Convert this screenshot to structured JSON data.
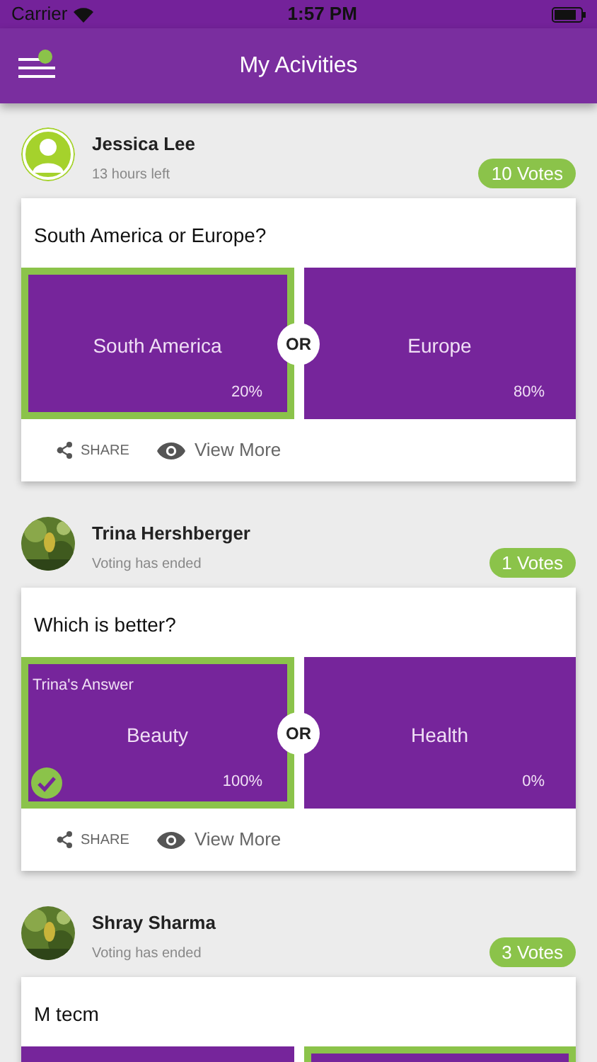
{
  "status_bar": {
    "carrier": "Carrier",
    "time": "1:57 PM"
  },
  "nav": {
    "title": "My Acivities",
    "menu_dot": true
  },
  "posts": [
    {
      "author": "Jessica Lee",
      "subtitle": "13 hours left",
      "votes": "10 Votes",
      "avatar": {
        "kind": "default"
      },
      "question": "South America or Europe?",
      "or_label": "OR",
      "options": [
        {
          "label": "South America",
          "percent": "20%",
          "selected": true,
          "checked": false
        },
        {
          "label": "Europe",
          "percent": "80%",
          "selected": false,
          "checked": false
        }
      ],
      "share": "SHARE",
      "view_more": "View More"
    },
    {
      "author": "Trina Hershberger",
      "subtitle": "Voting has ended",
      "votes": "1 Votes",
      "avatar": {
        "kind": "picture"
      },
      "question": "Which is better?",
      "or_label": "OR",
      "options": [
        {
          "answer_label": "Trina's Answer",
          "label": "Beauty",
          "percent": "100%",
          "selected": true,
          "checked": true
        },
        {
          "label": "Health",
          "percent": "0%",
          "selected": false,
          "checked": false
        }
      ],
      "share": "SHARE",
      "view_more": "View More"
    },
    {
      "author": "Shray Sharma",
      "subtitle": "Voting has ended",
      "votes": "3 Votes",
      "avatar": {
        "kind": "picture"
      },
      "question": "M tecm",
      "options": [
        {
          "selected": false
        },
        {
          "selected": true
        }
      ]
    }
  ]
}
